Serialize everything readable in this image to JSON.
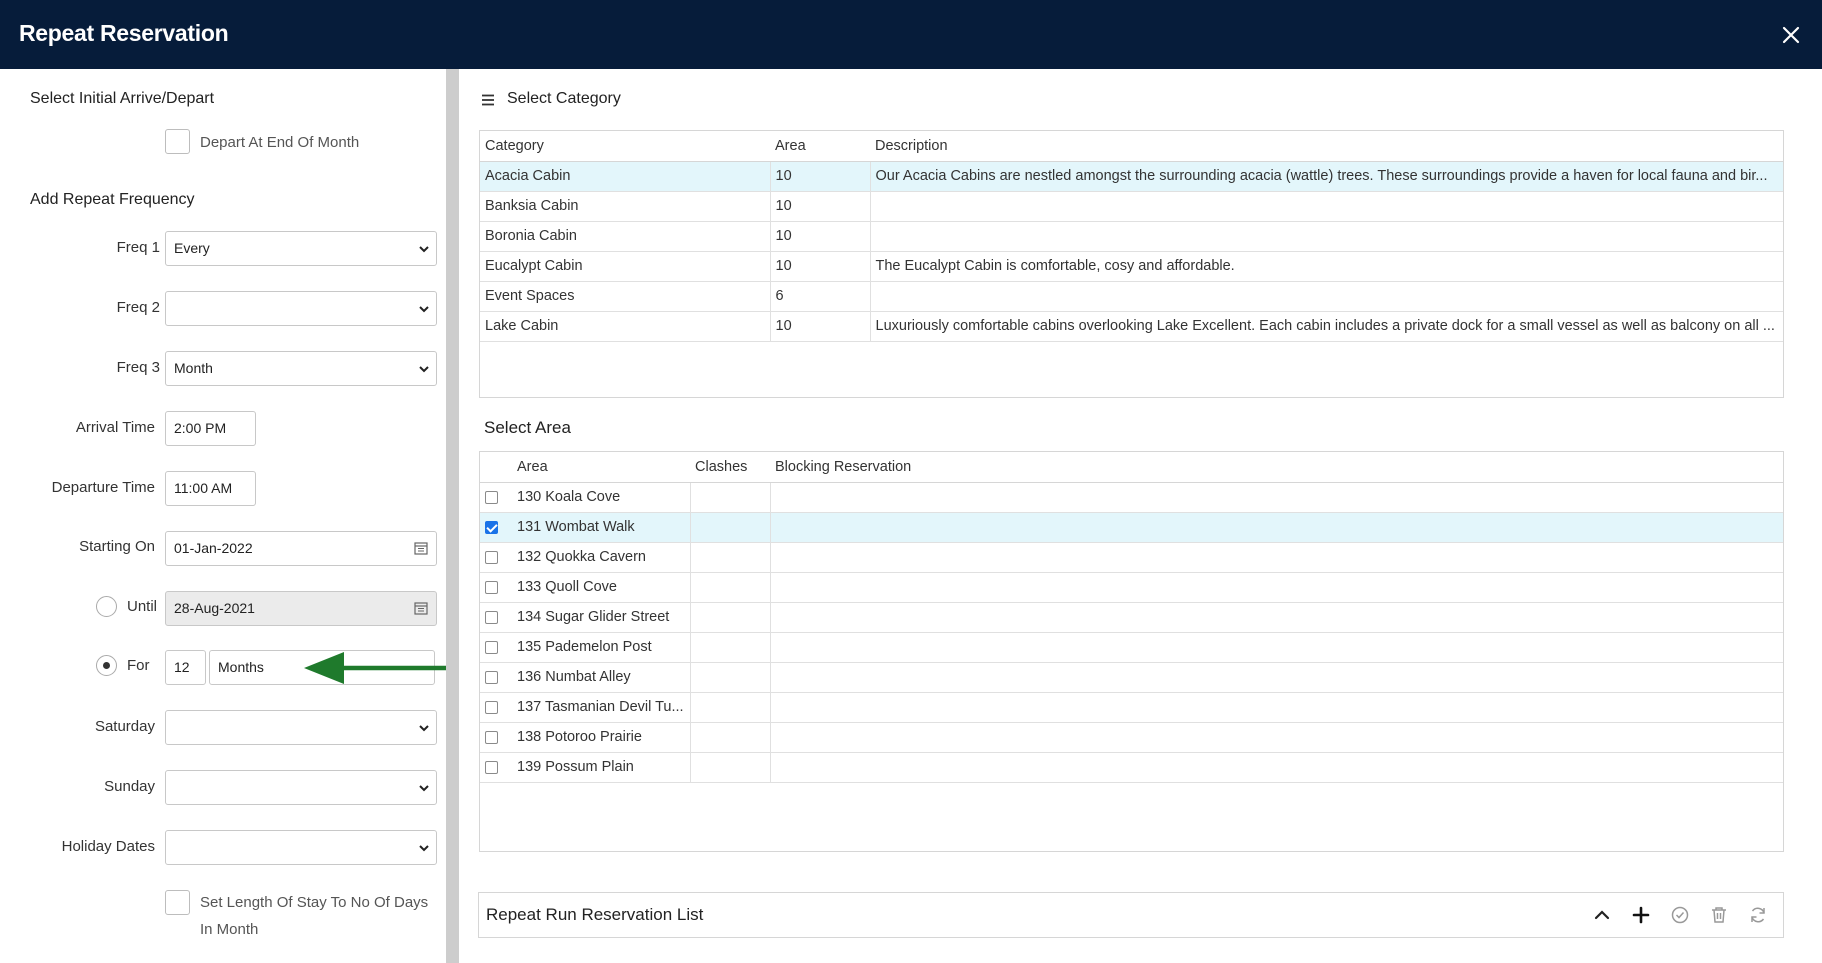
{
  "window": {
    "title": "Repeat Reservation",
    "close_icon": "close-icon"
  },
  "left": {
    "initial_heading": "Select Initial Arrive/Depart",
    "depart_end_month_label": "Depart At End Of Month",
    "depart_end_month_checked": false,
    "frequency_heading": "Add Repeat Frequency",
    "freq1": {
      "label": "Freq 1",
      "value": "Every"
    },
    "freq2": {
      "label": "Freq 2",
      "value": ""
    },
    "freq3": {
      "label": "Freq 3",
      "value": "Month"
    },
    "arrival_time": {
      "label": "Arrival Time",
      "value": "2:00 PM"
    },
    "departure_time": {
      "label": "Departure Time",
      "value": "11:00 AM"
    },
    "starting_on": {
      "label": "Starting On",
      "value": "01-Jan-2022"
    },
    "until": {
      "label": "Until",
      "value": "28-Aug-2021",
      "selected": false
    },
    "for": {
      "label": "For",
      "count": "12",
      "unit": "Months",
      "selected": true
    },
    "saturday": {
      "label": "Saturday",
      "value": ""
    },
    "sunday": {
      "label": "Sunday",
      "value": ""
    },
    "holiday_dates": {
      "label": "Holiday Dates",
      "value": ""
    },
    "set_length_label_1": "Set Length Of Stay To No Of Days",
    "set_length_label_2": "In Month",
    "set_length_checked": false
  },
  "category": {
    "heading": "Select Category",
    "menu_icon": "hamburger-menu-icon",
    "columns": [
      "Category",
      "Area",
      "Description"
    ],
    "rows": [
      {
        "category": "Acacia Cabin",
        "area": "10",
        "description": "Our Acacia Cabins are nestled amongst the surrounding acacia (wattle) trees. These surroundings provide a haven for local fauna and bir...",
        "selected": true
      },
      {
        "category": "Banksia Cabin",
        "area": "10",
        "description": ""
      },
      {
        "category": "Boronia Cabin",
        "area": "10",
        "description": ""
      },
      {
        "category": "Eucalypt Cabin",
        "area": "10",
        "description": "The Eucalypt Cabin is comfortable, cosy and affordable."
      },
      {
        "category": "Event Spaces",
        "area": "6",
        "description": ""
      },
      {
        "category": "Lake Cabin",
        "area": "10",
        "description": "Luxuriously comfortable cabins overlooking Lake Excellent. Each cabin includes a private dock for a small vessel as well as balcony on all ..."
      }
    ]
  },
  "area": {
    "heading": "Select Area",
    "columns": [
      "Area",
      "Clashes",
      "Blocking Reservation"
    ],
    "rows": [
      {
        "area": "130 Koala Cove",
        "checked": false
      },
      {
        "area": "131 Wombat Walk",
        "checked": true
      },
      {
        "area": "132 Quokka Cavern",
        "checked": false
      },
      {
        "area": "133 Quoll Cove",
        "checked": false
      },
      {
        "area": "134 Sugar Glider Street",
        "checked": false
      },
      {
        "area": "135 Pademelon Post",
        "checked": false
      },
      {
        "area": "136 Numbat Alley",
        "checked": false
      },
      {
        "area": "137 Tasmanian Devil Tu...",
        "checked": false
      },
      {
        "area": "138 Potoroo Prairie",
        "checked": false
      },
      {
        "area": "139 Possum Plain",
        "checked": false
      }
    ]
  },
  "repeat_list": {
    "title": "Repeat Run Reservation List",
    "icons": [
      "chevron-up-icon",
      "plus-icon",
      "check-circle-icon",
      "trash-icon",
      "refresh-icon"
    ]
  },
  "colors": {
    "titlebar": "#061c3a",
    "selected_row": "#e3f6fb",
    "arrow": "#1f7a2c"
  }
}
